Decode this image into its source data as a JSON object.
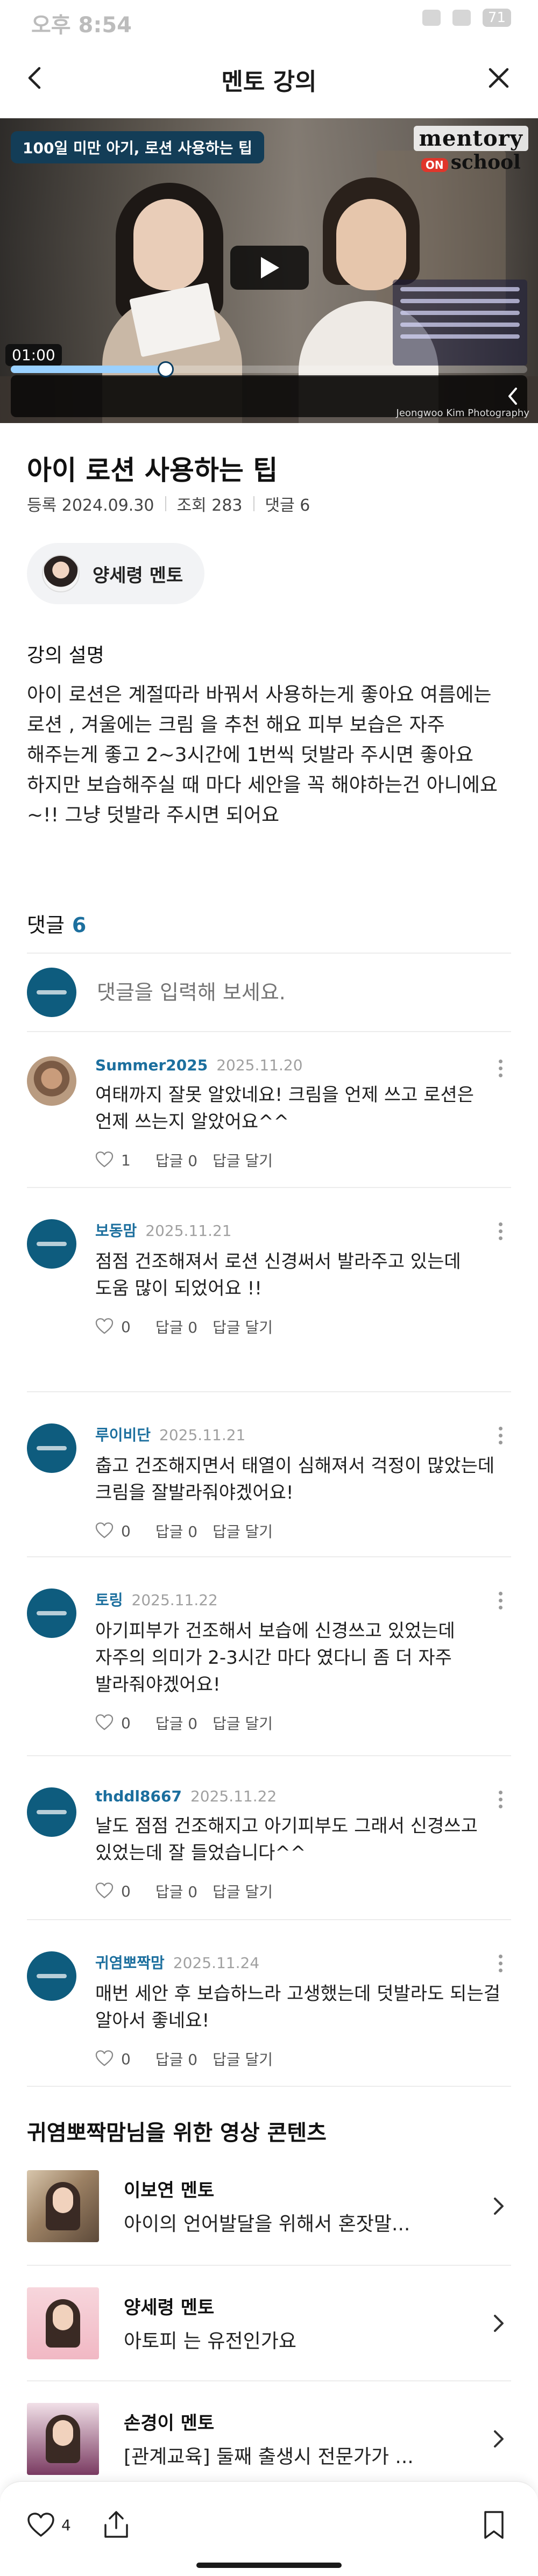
{
  "status_bar": {
    "time": "오후 8:54",
    "battery": "71"
  },
  "header": {
    "title": "멘토 강의",
    "back_icon": "chevron-left-icon",
    "close_icon": "close-icon"
  },
  "video": {
    "tag": "100일 미만 아기, 로션 사용하는 팁",
    "logo_main": "mentory",
    "logo_on": "ON",
    "logo_sub": "school",
    "elapsed": "01:00",
    "progress": 0.3,
    "credit": "Jeongwoo Kim Photography"
  },
  "lecture": {
    "title": "아이 로션 사용하는 팁",
    "date_label": "등록 2024.09.30",
    "views_label": "조회 283",
    "comments_label": "댓글 6",
    "mentor_chip": "양세령 멘토",
    "desc_heading": "강의 설명",
    "description": "아이 로션은 계절따라 바꿔서 사용하는게 좋아요 여름에는 로션 , 겨울에는 크림 을 추천 해요 피부 보습은 자주 해주는게 좋고 2~3시간에 1번씩 덧발라 주시면 좋아요 하지만 보습해주실 때 마다 세안을 꼭 해야하는건 아니에요 ~!! 그냥 덧발라 주시면 되어요"
  },
  "comments_section": {
    "heading": "댓글",
    "count": "6",
    "input_placeholder": "댓글을 입력해 보세요.",
    "reply_label": "답글 0",
    "write_reply_label": "답글 달기",
    "items": [
      {
        "name": "Summer2025",
        "date": "2025.11.20",
        "text": "여태까지 잘못 알았네요! 크림을 언제 쓰고 로션은 언제 쓰는지 알았어요^^",
        "likes": "1",
        "avatar": "photo"
      },
      {
        "name": "보동맘",
        "date": "2025.11.21",
        "text": "점점 건조해져서 로션 신경써서 발라주고 있는데\n도움 많이 되었어요 !!",
        "likes": "0",
        "avatar": "logo"
      },
      {
        "name": "루이비단",
        "date": "2025.11.21",
        "text": "춥고 건조해지면서 태열이 심해져서 걱정이 많았는데 크림을 잘발라줘야겠어요!",
        "likes": "0",
        "avatar": "logo"
      },
      {
        "name": "토링",
        "date": "2025.11.22",
        "text": "아기피부가 건조해서 보습에 신경쓰고 있었는데 자주의 의미가 2-3시간 마다 였다니 좀 더 자주 발라줘야겠어요!",
        "likes": "0",
        "avatar": "logo"
      },
      {
        "name": "thddl8667",
        "date": "2025.11.22",
        "text": "날도 점점 건조해지고 아기피부도 그래서 신경쓰고 있었는데 잘 들었습니다^^",
        "likes": "0",
        "avatar": "logo"
      },
      {
        "name": "귀염뽀짝맘",
        "date": "2025.11.24",
        "text": "매번 세안 후 보습하느라 고생했는데 덧발라도 되는걸 알아서 좋네요!",
        "likes": "0",
        "avatar": "logo"
      }
    ]
  },
  "recommended": {
    "heading": "귀염뽀짝맘님을 위한 영상 콘텐츠",
    "items": [
      {
        "mentor": "이보연 멘토",
        "title": "아이의 언어발달을 위해서 혼잣말..."
      },
      {
        "mentor": "양세령 멘토",
        "title": "아토피 는 유전인가요"
      },
      {
        "mentor": "손경이 멘토",
        "title": "[관계교육] 둘째 출생시 전문가가 ..."
      }
    ]
  },
  "bottom_bar": {
    "like_count": "4"
  },
  "colors": {
    "accent": "#1c6f9e",
    "video_tag_bg": "#133d57",
    "chip_bg": "#f2f3f5",
    "logo_avatar_bg": "#0e5c7e"
  }
}
